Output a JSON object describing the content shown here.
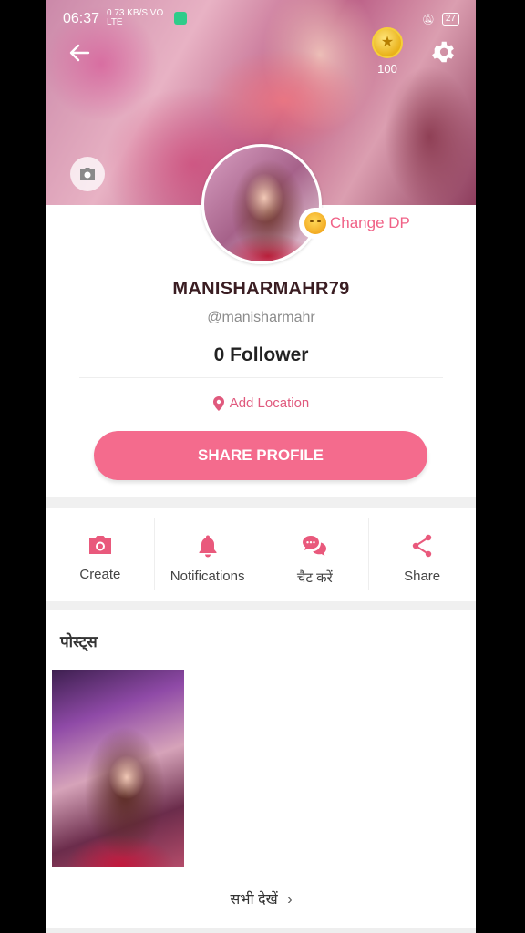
{
  "status_bar": {
    "time": "06:37",
    "network": "0.73 KB/S VO LTE",
    "battery": "27"
  },
  "header": {
    "coins": "100"
  },
  "profile": {
    "change_dp_label": "Change DP",
    "username": "MANISHARMAHR79",
    "handle": "@manisharmahr",
    "followers": "0 Follower",
    "location_label": "Add Location",
    "share_profile_label": "SHARE PROFILE"
  },
  "actions": [
    {
      "label": "Create",
      "icon": "camera-icon"
    },
    {
      "label": "Notifications",
      "icon": "bell-icon"
    },
    {
      "label": "चैट करें",
      "icon": "chat-icon"
    },
    {
      "label": "Share",
      "icon": "share-icon"
    }
  ],
  "posts": {
    "title": "पोस्ट्स",
    "see_all": "सभी देखें"
  },
  "colors": {
    "accent": "#f46b8d",
    "accent_text": "#e0597d",
    "username": "#3a1d22"
  }
}
